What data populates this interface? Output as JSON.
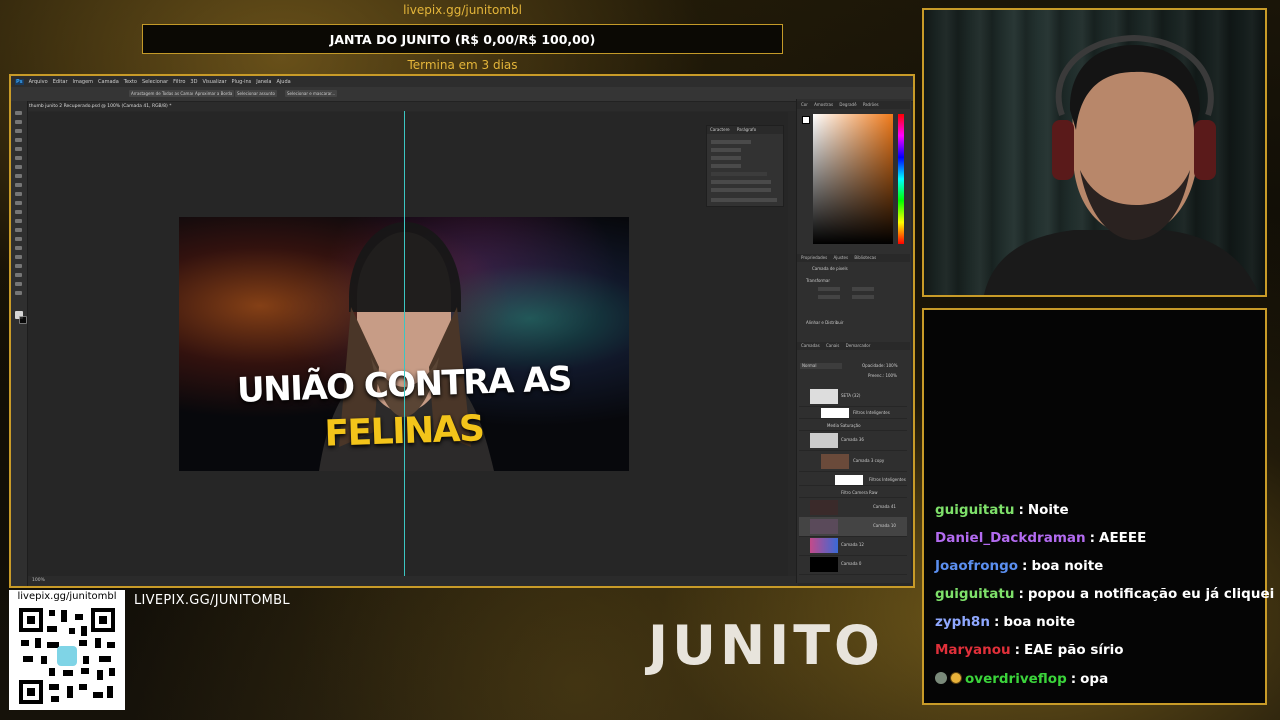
{
  "overlay": {
    "top_url": "livepix.gg/junitombl",
    "goal_label": "JANTA DO JUNITO (R$ 0,00/R$ 100,00)",
    "goal_progress": 0.0,
    "goal_ends": "Termina em 3 dias",
    "qr_label": "livepix.gg/junitombl",
    "bottom_url": "LIVEPIX.GG/JUNITOMBL",
    "logo_text": "JUNITO",
    "accent_color": "#c89b28"
  },
  "photoshop": {
    "menu": [
      "Ps",
      "Arquivo",
      "Editar",
      "Imagem",
      "Camada",
      "Texto",
      "Selecionar",
      "Filtro",
      "3D",
      "Visualizar",
      "Plug-ins",
      "Janela",
      "Ajuda"
    ],
    "options": [
      "Arrastagem de Todas as Camadas",
      "Aproximar a Borda",
      "Selecionar assunto",
      "Selecionar e mascarar..."
    ],
    "doc_tab": "thumb junito 2 Recuperado.psd @ 100% (Camada 41, RGB/8) *",
    "status": "100%",
    "thumbnail": {
      "line1": "UNIÃO CONTRA AS",
      "line2": "FELINAS"
    },
    "char_panel": {
      "tab1": "Caractere",
      "tab2": "Parágrafo"
    },
    "color_panel": {
      "tabs": [
        "Cor",
        "Amostras",
        "Degradê",
        "Padrões"
      ]
    },
    "props_panel": {
      "tabs": [
        "Propriedades",
        "Ajustes",
        "Bibliotecas"
      ],
      "title": "Camada de pixels",
      "section": "Transformar",
      "align": "Alinhar e Distribuir"
    },
    "layers_panel": {
      "tabs": [
        "Camadas",
        "Canais",
        "Demarcador"
      ],
      "blend": "Normal",
      "opacity": "Opacidade: 100%",
      "fill": "Preenc.: 100%",
      "layers": [
        {
          "name": "SETA (32)"
        },
        {
          "name": "Filtros Inteligentes"
        },
        {
          "name": "Media Saturação"
        },
        {
          "name": "Camada 36"
        },
        {
          "name": "Camada 3 copy"
        },
        {
          "name": "Filtros Inteligentes"
        },
        {
          "name": "Filtro Camera Raw"
        },
        {
          "name": "Camada 41"
        },
        {
          "name": "Camada 10"
        },
        {
          "name": "Camada 12"
        },
        {
          "name": "Camada 0"
        }
      ]
    }
  },
  "chat": {
    "messages": [
      {
        "user": "guiguitatu",
        "color": "#7ee06a",
        "text": "Noite"
      },
      {
        "user": "Daniel_Dackdraman",
        "color": "#b36bf0",
        "text": "AEEEE"
      },
      {
        "user": "Joaofrongo",
        "color": "#5b8ff0",
        "text": "boa noite"
      },
      {
        "user": "guiguitatu",
        "color": "#7ee06a",
        "text": "popou a notificação eu já cliquei"
      },
      {
        "user": "zyph8n",
        "color": "#8fa8ff",
        "text": "boa noite"
      },
      {
        "user": "Maryanou",
        "color": "#e0303a",
        "text": "EAE pão sírio"
      },
      {
        "user": "overdriveflop",
        "color": "#3bd43b",
        "text": "opa",
        "badges": [
          "mod-icon",
          "sub-badge"
        ]
      }
    ]
  }
}
